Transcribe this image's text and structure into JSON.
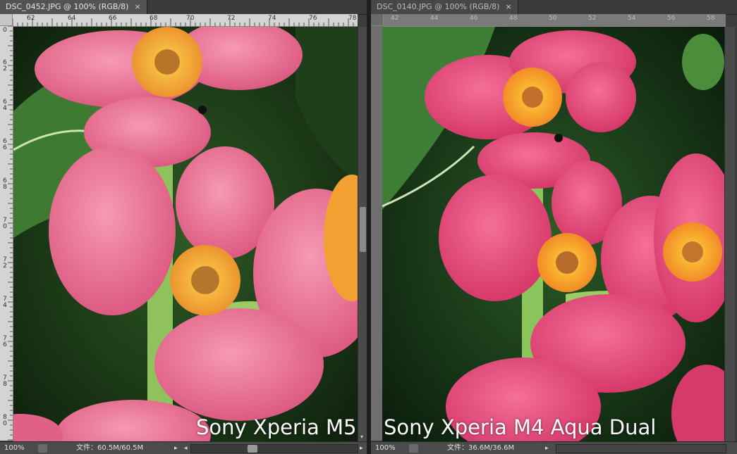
{
  "left": {
    "tab_title": "DSC_0452.JPG @ 100% (RGB/8)",
    "close_glyph": "×",
    "hruler_ticks": [
      "62",
      "64",
      "66",
      "68",
      "70",
      "72",
      "74",
      "76",
      "78"
    ],
    "vruler_ticks": [
      "0",
      "6\n2",
      "6\n4",
      "6\n6",
      "6\n8",
      "7\n0",
      "7\n2",
      "7\n4",
      "7\n6",
      "7\n8",
      "8\n0"
    ],
    "caption": "Sony Xperia M5",
    "status": {
      "zoom": "100%",
      "doc_size": "文件：60.5M/60.5M"
    }
  },
  "right": {
    "tab_title": "DSC_0140.JPG @ 100% (RGB/8)",
    "close_glyph": "×",
    "hruler_ticks": [
      "42",
      "44",
      "46",
      "48",
      "50",
      "52",
      "54",
      "56",
      "58"
    ],
    "caption": "Sony Xperia M4 Aqua Dual",
    "status": {
      "zoom": "100%",
      "doc_size": "文件：36.6M/36.6M"
    }
  },
  "icons": {
    "scroll_left": "◂",
    "scroll_right": "▸",
    "scroll_down": "▾"
  },
  "colors": {
    "petal": "#e75f86",
    "petal_light": "#f288a4",
    "leaf": "#2f6b2a",
    "stem": "#8cc25a",
    "center": "#f2a032"
  }
}
